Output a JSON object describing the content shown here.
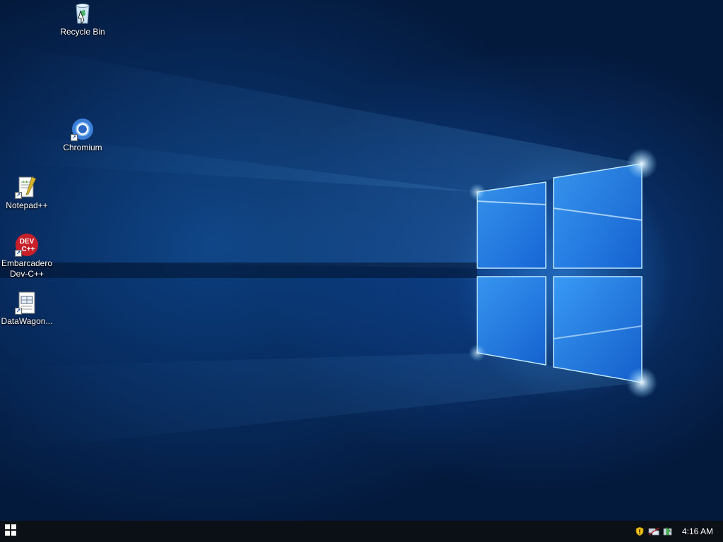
{
  "desktop": {
    "icons": [
      {
        "label": "Recycle Bin",
        "icon": "recycle-bin-icon"
      },
      {
        "label": "Chromium",
        "icon": "chromium-icon"
      },
      {
        "label": "Notepad++",
        "icon": "notepad-plus-plus-icon"
      },
      {
        "label": "Embarcadero\nDev-C++",
        "icon": "dev-cpp-icon"
      },
      {
        "label": "DataWagon...",
        "icon": "datawagon-icon"
      }
    ],
    "devcpp_badge_top": "DEV",
    "devcpp_badge_bottom": "C++"
  },
  "taskbar": {
    "start_icon": "windows-logo-icon",
    "tray_icons": [
      "security-shield-icon",
      "network-icon",
      "update-icon"
    ],
    "clock": "4:16 AM"
  },
  "colors": {
    "taskbar_bg": "#0b0f16",
    "wallpaper_blue": "#0a4fae",
    "accent_light": "#7fd0ff"
  }
}
